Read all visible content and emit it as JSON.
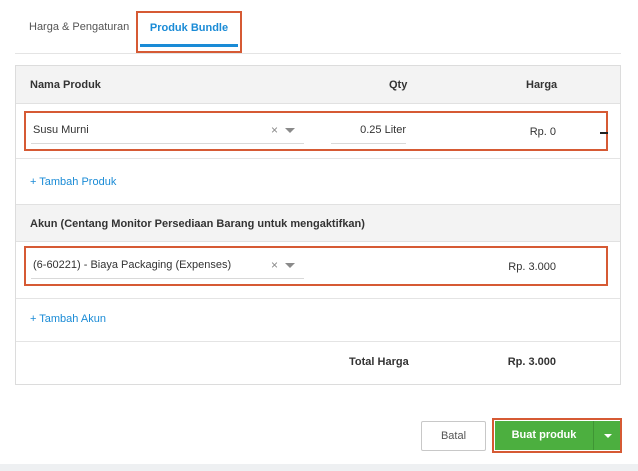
{
  "tabs": {
    "general": "Harga & Pengaturan",
    "bundle": "Produk Bundle"
  },
  "product_table": {
    "headers": {
      "name": "Nama Produk",
      "qty": "Qty",
      "price": "Harga"
    },
    "rows": [
      {
        "product": "Susu Murni",
        "qty": "0.25 Liter",
        "price": "Rp. 0"
      }
    ],
    "add_link": "+ Tambah Produk"
  },
  "account_table": {
    "header": "Akun (Centang Monitor Persediaan Barang untuk mengaktifkan)",
    "rows": [
      {
        "account": "(6-60221) - Biaya Packaging (Expenses)",
        "price": "Rp. 3.000"
      }
    ],
    "add_link": "+ Tambah Akun"
  },
  "total": {
    "label": "Total Harga",
    "value": "Rp. 3.000"
  },
  "actions": {
    "cancel": "Batal",
    "create": "Buat produk"
  },
  "icons": {
    "clear": "×"
  },
  "colors": {
    "accent": "#1a8bd6",
    "primary_button": "#4caf3f",
    "highlight": "#d65a34"
  }
}
